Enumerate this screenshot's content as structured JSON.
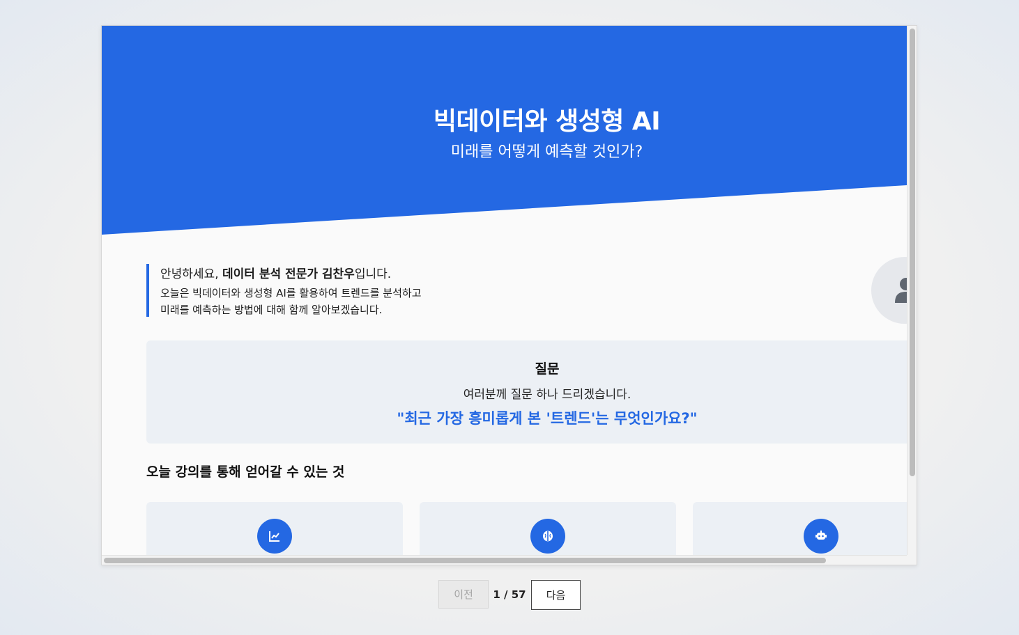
{
  "slide": {
    "title": "빅데이터와 생성형 AI",
    "subtitle": "미래를 어떻게 예측할 것인가?",
    "intro": {
      "greeting_prefix": "안녕하세요, ",
      "greeting_bold": "데이터 분석 전문가 김찬우",
      "greeting_suffix": "입니다.",
      "line2": "오늘은 빅데이터와 생성형 AI를 활용하여 트렌드를 분석하고",
      "line3": "미래를 예측하는 방법에 대해 함께 알아보겠습니다."
    },
    "question": {
      "title": "질문",
      "body": "여러분께 질문 하나 드리겠습니다.",
      "quote": "\"최근 가장 흥미롭게 본 '트렌드'는 무엇인가요?\""
    },
    "section_title": "오늘 강의를 통해 얻어갈 수 있는 것",
    "cards": [
      {
        "icon": "chart-line-icon"
      },
      {
        "icon": "brain-icon"
      },
      {
        "icon": "robot-icon"
      }
    ]
  },
  "colors": {
    "accent": "#2468e3",
    "card_bg": "#ecf0f5",
    "page_bg": "#fafafa"
  },
  "nav": {
    "prev_label": "이전",
    "next_label": "다음",
    "page_indicator": "1 / 57"
  }
}
